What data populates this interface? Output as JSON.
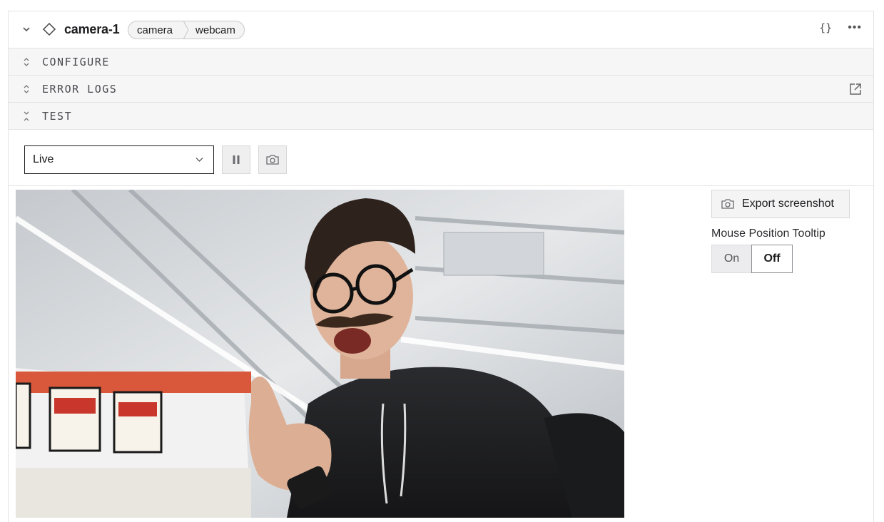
{
  "component": {
    "name": "camera-1",
    "breadcrumb": [
      "camera",
      "webcam"
    ],
    "json_icon_text": "{}",
    "more_icon_text": "•••"
  },
  "sections": {
    "configure": "CONFIGURE",
    "error_logs": "ERROR LOGS",
    "test": "TEST"
  },
  "controls": {
    "stream_mode": "Live",
    "pause_icon": "pause-icon",
    "snapshot_icon": "camera-icon"
  },
  "sidebar": {
    "export_label": "Export screenshot",
    "tooltip_label": "Mouse Position Tooltip",
    "toggle_on": "On",
    "toggle_off": "Off",
    "toggle_selected": "Off"
  },
  "colors": {
    "border": "#e4e4e6",
    "section_bg": "#f6f6f7",
    "text": "#1c1c1e",
    "wall_accent": "#d9573a"
  }
}
